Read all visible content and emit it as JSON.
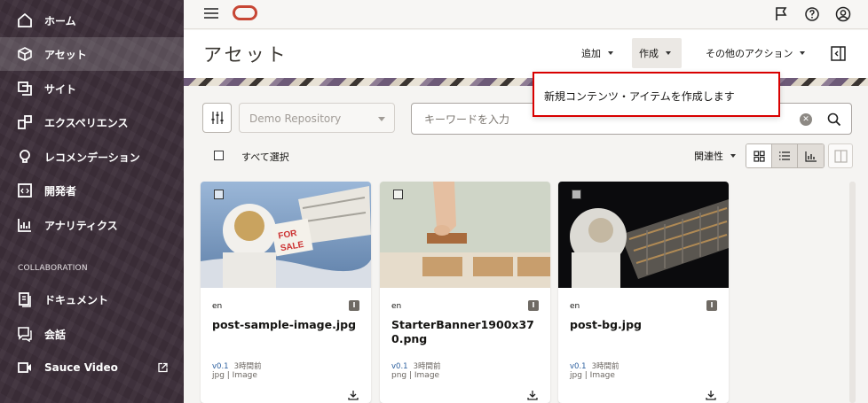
{
  "sidebar": {
    "items": [
      {
        "label": "ホーム",
        "icon": "home-icon"
      },
      {
        "label": "アセット",
        "icon": "cube-icon",
        "active": true
      },
      {
        "label": "サイト",
        "icon": "sites-icon"
      },
      {
        "label": "エクスペリエンス",
        "icon": "experience-icon"
      },
      {
        "label": "レコメンデーション",
        "icon": "lightbulb-icon"
      },
      {
        "label": "開発者",
        "icon": "code-icon"
      },
      {
        "label": "アナリティクス",
        "icon": "analytics-icon"
      }
    ],
    "section_label": "COLLABORATION",
    "collab_items": [
      {
        "label": "ドキュメント",
        "icon": "documents-icon"
      },
      {
        "label": "会話",
        "icon": "conversation-icon"
      },
      {
        "label": "Sauce Video",
        "icon": "video-icon"
      }
    ]
  },
  "header": {
    "title": "アセット",
    "add_label": "追加",
    "create_label": "作成",
    "other_actions_label": "その他のアクション"
  },
  "toolbar": {
    "repository": "Demo Repository",
    "search_placeholder": "キーワードを入力",
    "select_all_label": "すべて選択",
    "sort_label": "関連性"
  },
  "tooltip": {
    "text": "新規コンテンツ・アイテムを作成します"
  },
  "assets": [
    {
      "name": "post-sample-image.jpg",
      "lang": "en",
      "badge": "I",
      "version": "v0.1",
      "time": "3時間前",
      "type": "jpg | Image"
    },
    {
      "name": "StarterBanner1900x370.png",
      "lang": "en",
      "badge": "I",
      "version": "v0.1",
      "time": "3時間前",
      "type": "png | Image"
    },
    {
      "name": "post-bg.jpg",
      "lang": "en",
      "badge": "I",
      "version": "v0.1",
      "time": "3時間前",
      "type": "jpg | Image"
    }
  ],
  "colors": {
    "brand": "#c74634",
    "sidebar_bg": "#3d2f3a",
    "highlight": "#d90000",
    "link": "#2b5f9e"
  }
}
